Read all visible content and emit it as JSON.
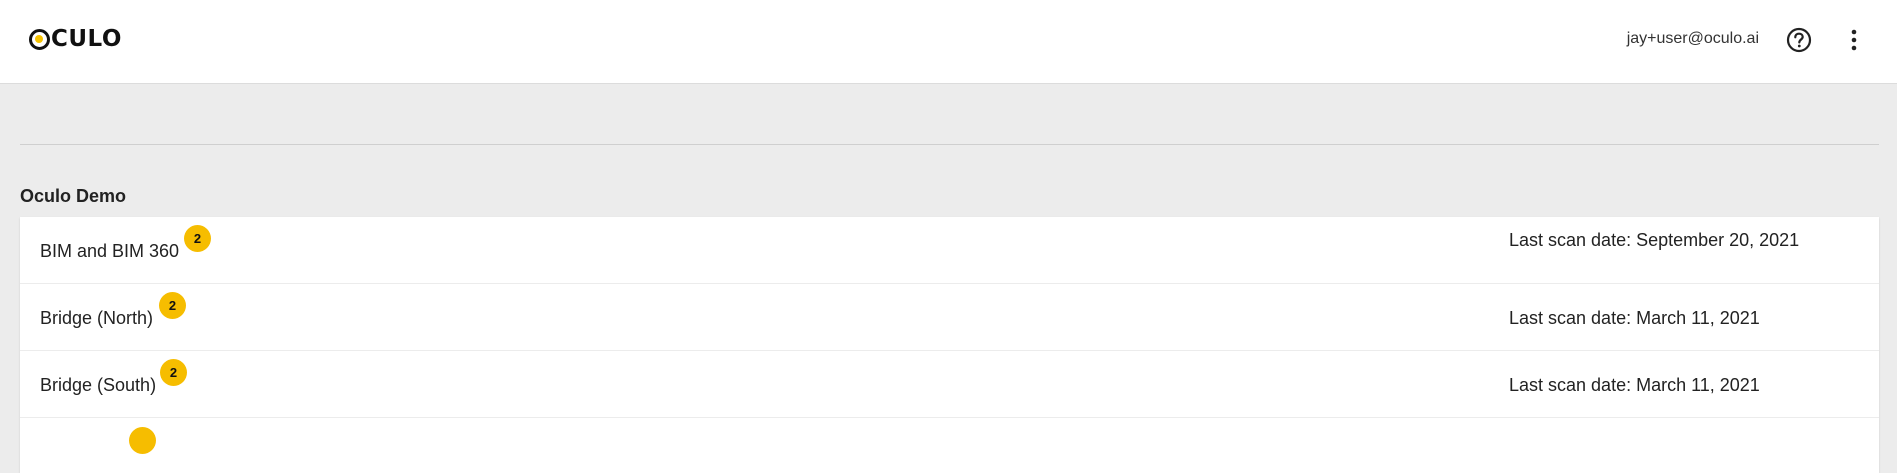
{
  "header": {
    "logo_text": "CULO",
    "user_email": "jay+user@oculo.ai",
    "icons": {
      "help": "help-circle-icon",
      "more": "more-vertical-icon"
    }
  },
  "group": {
    "title": "Oculo Demo"
  },
  "projects": [
    {
      "name": "BIM and BIM 360",
      "badge": "2",
      "last_scan": "Last scan date: September 20, 2021"
    },
    {
      "name": "Bridge (North)",
      "badge": "2",
      "last_scan": "Last scan date: March 11, 2021"
    },
    {
      "name": "Bridge (South)",
      "badge": "2",
      "last_scan": "Last scan date: March 11, 2021"
    }
  ],
  "colors": {
    "accent": "#f6bd00",
    "background": "#ececec",
    "surface": "#ffffff"
  }
}
